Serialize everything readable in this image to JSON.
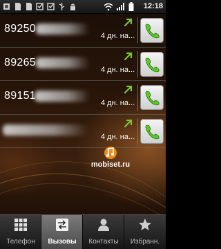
{
  "status_bar": {
    "time": "12:18",
    "icons": [
      "notification-icon",
      "sd-card-icon",
      "sd-card-icon",
      "checkbox-icon",
      "checkbox-icon",
      "usb-icon",
      "android-debug-icon",
      "wifi-icon",
      "signal-icon",
      "battery-icon"
    ]
  },
  "calls": [
    {
      "number": "89250",
      "time": "4 дн. на...",
      "type": "outgoing-call-icon"
    },
    {
      "number": "89265",
      "time": "4 дн. на...",
      "type": "outgoing-call-icon"
    },
    {
      "number": "89151",
      "time": "4 дн. на...",
      "type": "outgoing-call-icon"
    },
    {
      "number": "",
      "time": "4 дн. на...",
      "type": "outgoing-call-icon"
    }
  ],
  "watermark": {
    "text": "mobiset.ru"
  },
  "tabs": [
    {
      "label": "Телефон",
      "icon": "dialpad-icon"
    },
    {
      "label": "Вызовы",
      "icon": "call-log-icon",
      "active": true
    },
    {
      "label": "Контакты",
      "icon": "contacts-icon"
    },
    {
      "label": "Избранн.",
      "icon": "star-icon"
    }
  ],
  "colors": {
    "accent_green": "#5cc62a",
    "call_arrow": "#7bc43a"
  }
}
